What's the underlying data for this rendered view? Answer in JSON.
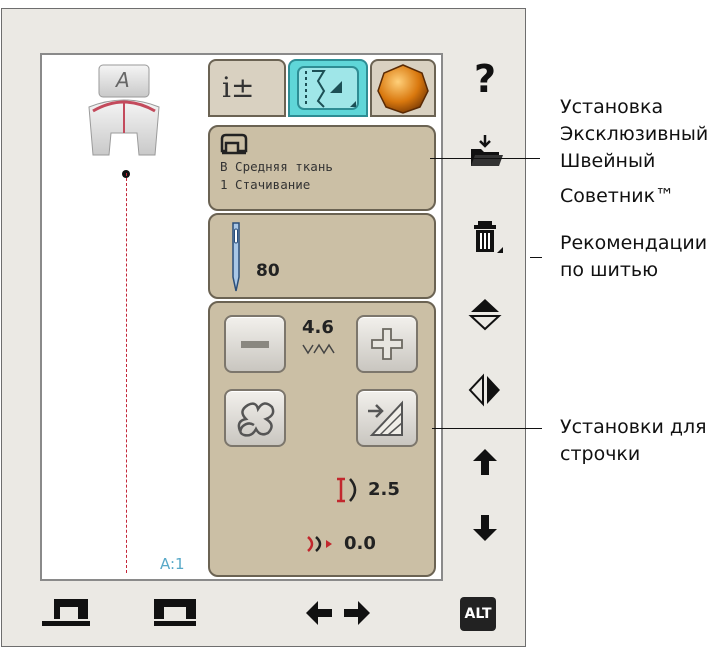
{
  "screen": {
    "foot_letter": "A",
    "pattern_label": "A:1",
    "tabs": [
      {
        "name": "info",
        "label": "i±"
      },
      {
        "name": "stitch"
      },
      {
        "name": "thread-color"
      }
    ],
    "fabric": {
      "line1": "В Средняя ткань",
      "line2": "1 Стачивание"
    },
    "needle": {
      "size": "80"
    },
    "settings": {
      "stitch_width": "4.6",
      "stitch_length": "2.5",
      "stitch_positioning": "0.0"
    }
  },
  "right_toolbar": {
    "help": "?",
    "icons": [
      "help-icon",
      "load-folder-icon",
      "trash-icon",
      "mirror-vertical-icon",
      "mirror-horizontal-icon",
      "arrow-up-icon",
      "arrow-down-icon"
    ]
  },
  "bottom_toolbar": {
    "alt_label": "ALT"
  },
  "callouts": {
    "advisor": [
      "Установка",
      "Эксклюзивный",
      "Швейный",
      "Советник™"
    ],
    "recommendations": [
      "Рекомендации",
      "по шитью"
    ],
    "stitch_settings": [
      "Установки для",
      "строчки"
    ]
  }
}
